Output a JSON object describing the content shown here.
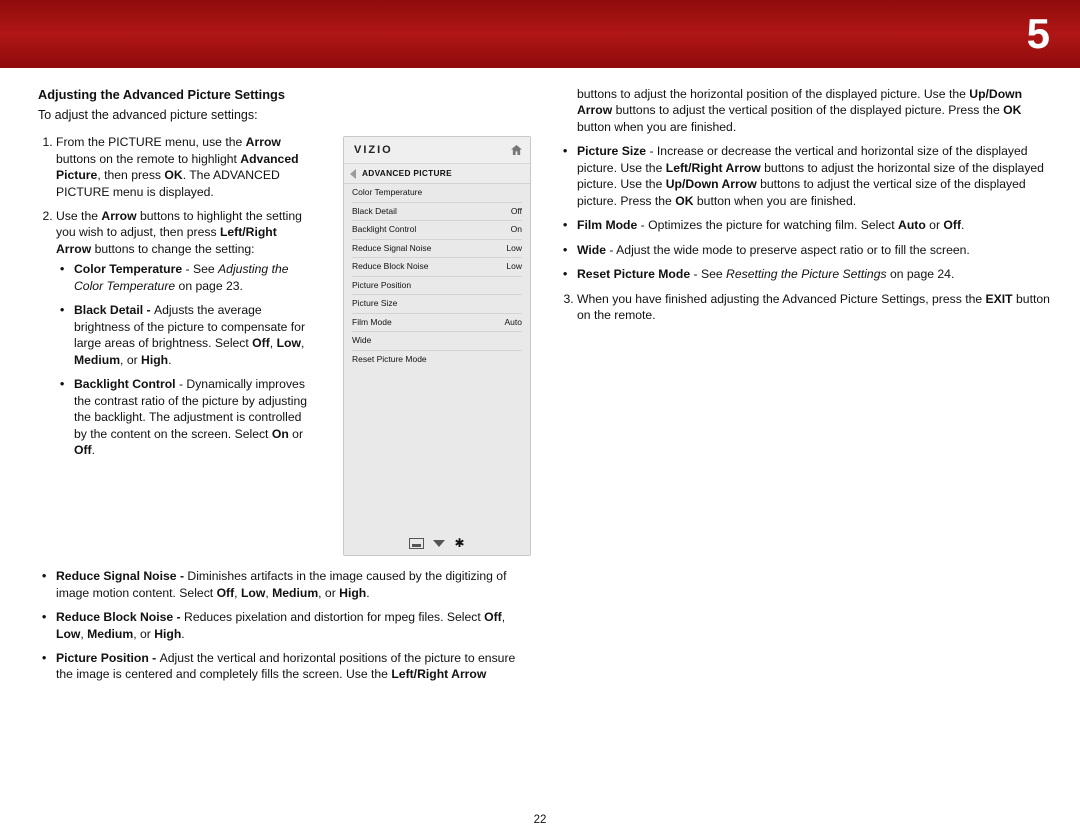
{
  "chapter": "5",
  "page_number": "22",
  "heading": "Adjusting the Advanced Picture Settings",
  "intro": "To adjust the advanced picture settings:",
  "step1": {
    "pre": "From the PICTURE menu, use the ",
    "b1": "Arrow",
    "mid1": " buttons on the remote to highlight ",
    "b2": "Advanced Picture",
    "mid2": ", then press ",
    "b3": "OK",
    "post": ". The ADVANCED PICTURE menu is displayed."
  },
  "step2": {
    "pre": "Use the ",
    "b1": "Arrow",
    "mid1": " buttons to highlight the setting you wish to adjust, then press ",
    "b2": "Left/Right Arrow",
    "post": " buttons to change the setting:"
  },
  "bullets_left": {
    "ct": {
      "label": "Color Temperature",
      "pre": " - See ",
      "ital": "Adjusting the Color Temperature",
      "post": " on page 23."
    },
    "bd": {
      "label": "Black Detail - ",
      "text": "Adjusts the average brightness of the picture to compensate for large areas of brightness. Select ",
      "o1": "Off",
      "o2": "Low",
      "o3": "Medium",
      "o4": "High"
    },
    "bc": {
      "label": "Backlight Control",
      "text": " - Dynamically improves the contrast ratio of the picture by adjusting the backlight. The adjustment is controlled by the content on the screen. Select ",
      "o1": "On",
      "o2": "Off"
    },
    "rsn": {
      "label": "Reduce Signal Noise - ",
      "text": "Diminishes artifacts in the image caused by the digitizing of image motion content. Select ",
      "o1": "Off",
      "o2": "Low",
      "o3": "Medium",
      "o4": "High"
    },
    "rbn": {
      "label": "Reduce Block Noise - ",
      "text": "Reduces pixelation and distortion for mpeg files. Select ",
      "o1": "Off",
      "o2": "Low",
      "o3": "Medium",
      "o4": "High"
    },
    "pp": {
      "label": "Picture Position - ",
      "text": "Adjust the vertical and horizontal positions of the picture to ensure the image is centered and completely fills the screen. Use the ",
      "b1": "Left/Right Arrow"
    }
  },
  "col2": {
    "cont": {
      "pre": "buttons to adjust the horizontal position of the displayed picture. Use the ",
      "b1": "Up/Down Arrow",
      "mid": " buttons to adjust the vertical position of the displayed picture. Press the ",
      "b2": "OK",
      "post": " button when you are finished."
    },
    "ps": {
      "label": "Picture Size",
      "pre": " - Increase or decrease the vertical and horizontal size of the displayed picture. Use the ",
      "b1": "Left/Right Arrow",
      "mid1": " buttons to adjust the horizontal size of the displayed picture. Use the ",
      "b2": "Up/Down Arrow",
      "mid2": " buttons to adjust the vertical size of the displayed picture. Press the ",
      "b3": "OK",
      "post": " button when you are finished."
    },
    "fm": {
      "label": "Film Mode",
      "text": " - Optimizes the picture for watching film. Select ",
      "o1": "Auto",
      "o2": "Off"
    },
    "wd": {
      "label": "Wide",
      "text": " - Adjust the wide mode to preserve aspect ratio or to fill the screen."
    },
    "rpm": {
      "label": "Reset Picture Mode",
      "pre": " - See ",
      "ital": "Resetting the Picture Settings",
      "post": " on page 24."
    },
    "step3": {
      "pre": "When you have finished adjusting the Advanced Picture Settings, press the ",
      "b1": "EXIT",
      "post": " button on the remote."
    }
  },
  "phone": {
    "brand": "VIZIO",
    "crumb": "ADVANCED PICTURE",
    "items": [
      {
        "name": "Color Temperature",
        "val": ""
      },
      {
        "name": "Black Detail",
        "val": "Off"
      },
      {
        "name": "Backlight Control",
        "val": "On"
      },
      {
        "name": "Reduce Signal Noise",
        "val": "Low"
      },
      {
        "name": "Reduce Block Noise",
        "val": "Low"
      },
      {
        "name": "Picture Position",
        "val": ""
      },
      {
        "name": "Picture Size",
        "val": ""
      },
      {
        "name": "Film Mode",
        "val": "Auto"
      },
      {
        "name": "Wide",
        "val": ""
      },
      {
        "name": "Reset Picture Mode",
        "val": ""
      }
    ]
  }
}
